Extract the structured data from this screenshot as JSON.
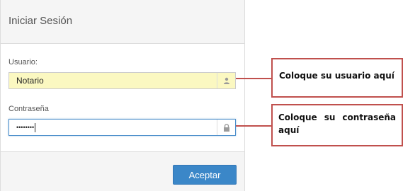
{
  "login_panel": {
    "title": "Iniciar Sesión",
    "username": {
      "label": "Usuario:",
      "value": "Notario",
      "icon": "user-icon"
    },
    "password": {
      "label": "Contraseña",
      "masked_value": "••••••••",
      "icon": "lock-icon"
    },
    "submit_label": "Aceptar"
  },
  "annotations": {
    "username_callout": "Coloque su usuario aquí",
    "password_callout": "Coloque su contraseña aquí"
  },
  "colors": {
    "callout_border": "#c0504d",
    "button_bg": "#3b87c8",
    "autofill_bg": "#fbf8c1",
    "focus_border": "#4d8fcb"
  }
}
